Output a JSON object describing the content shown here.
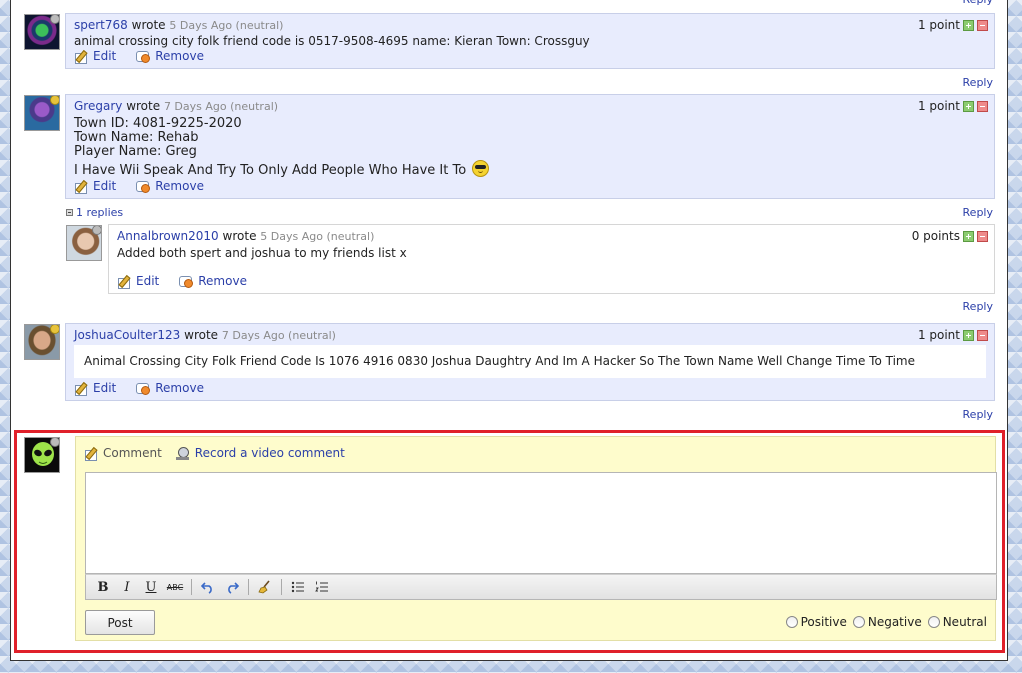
{
  "reply_label": "Reply",
  "edit_label": "Edit",
  "remove_label": "Remove",
  "comments": [
    {
      "user": "spert768",
      "wrote": "wrote",
      "meta": "5 Days Ago (neutral)",
      "points": "1 point",
      "lines": [
        "animal crossing city folk friend code is 0517-9508-4695 name: Kieran Town: Crossguy"
      ]
    },
    {
      "user": "Gregary",
      "wrote": "wrote",
      "meta": "7 Days Ago (neutral)",
      "points": "1 point",
      "lines": [
        "Town ID: 4081-9225-2020",
        "Town Name: Rehab",
        "Player Name: Greg",
        "I Have Wii Speak And Try To Only Add People Who Have It To"
      ],
      "replies_toggle": "1 replies",
      "reply": {
        "user": "Annalbrown2010",
        "wrote": "wrote",
        "meta": "5 Days Ago (neutral)",
        "points": "0 points",
        "text": "Added both spert and joshua to my friends list x"
      }
    },
    {
      "user": "JoshuaCoulter123",
      "wrote": "wrote",
      "meta": "7 Days Ago (neutral)",
      "points": "1 point",
      "text": "Animal Crossing City Folk Friend Code Is 1076 4916 0830 Joshua Daughtry And Im A Hacker So The Town Name Well Change Time To Time"
    }
  ],
  "new_comment": {
    "tab_comment": "Comment",
    "tab_video": "Record a video comment",
    "post_label": "Post",
    "ratings": [
      "Positive",
      "Negative",
      "Neutral"
    ]
  },
  "colors": {
    "comment_bg": "#e8ecfd",
    "new_comment_bg": "#fefccc",
    "highlight_border": "#e0202a",
    "link": "#2b3fa8"
  }
}
